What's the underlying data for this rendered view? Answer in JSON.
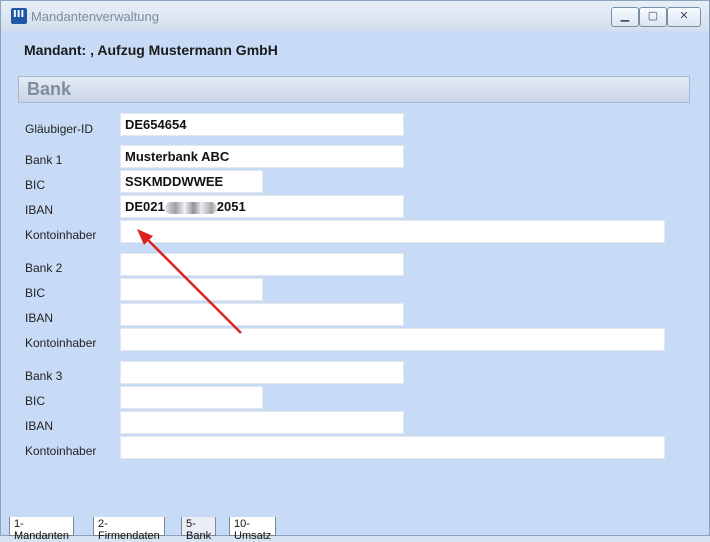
{
  "window": {
    "title": "Mandantenverwaltung",
    "icon": "app-logo-icon",
    "app_icon_text": "III"
  },
  "header": {
    "mandant_line": "Mandant: , Aufzug Mustermann GmbH"
  },
  "section": {
    "title": "Bank"
  },
  "fields": {
    "glaeubiger_label": "Gläubiger-ID",
    "glaeubiger_value": "DE654654",
    "bank1": {
      "bank_label": "Bank 1",
      "bank_value": "Musterbank ABC",
      "bic_label": "BIC",
      "bic_value": "SSKMDDWWEE",
      "iban_label": "IBAN",
      "iban_prefix": "DE021",
      "iban_suffix": "2051",
      "owner_label": "Kontoinhaber",
      "owner_value": ""
    },
    "bank2": {
      "bank_label": "Bank 2",
      "bank_value": "",
      "bic_label": "BIC",
      "bic_value": "",
      "iban_label": "IBAN",
      "iban_value": "",
      "owner_label": "Kontoinhaber",
      "owner_value": ""
    },
    "bank3": {
      "bank_label": "Bank 3",
      "bank_value": "",
      "bic_label": "BIC",
      "bic_value": "",
      "iban_label": "IBAN",
      "iban_value": "",
      "owner_label": "Kontoinhaber",
      "owner_value": ""
    }
  },
  "tabs": [
    "1-Mandanten",
    "2-Firmendaten",
    "5-Bank",
    "10-Umsatz"
  ],
  "colors": {
    "background": "#c7dbf7",
    "annotation_arrow": "#e02020"
  }
}
